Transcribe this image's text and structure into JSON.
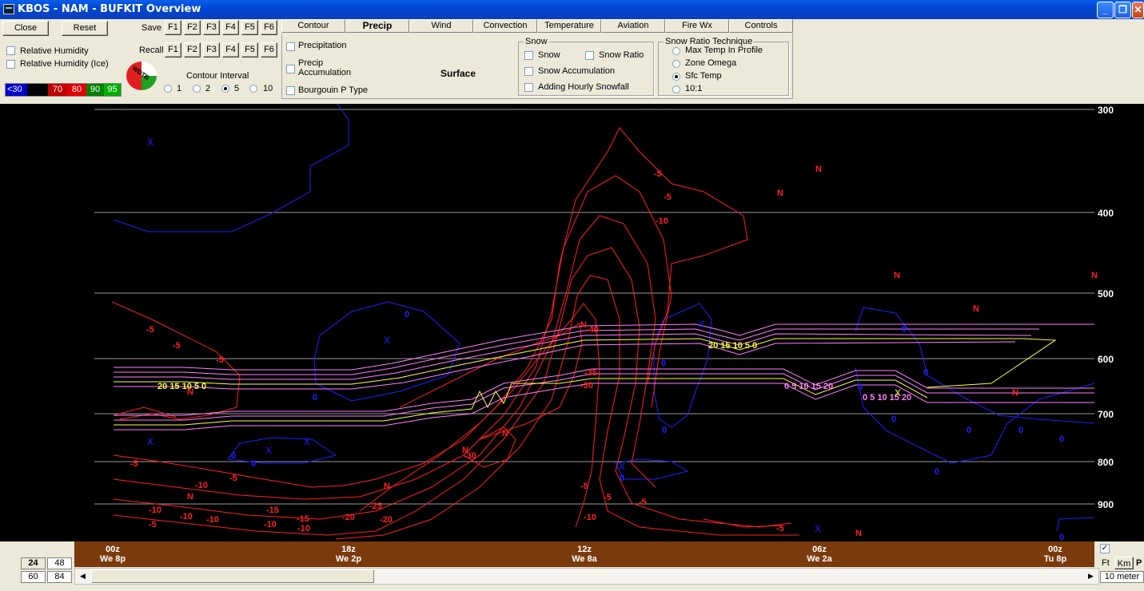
{
  "window": {
    "title": "KBOS - NAM - BUFKIT Overview",
    "controls": {
      "minimize": "_",
      "restore": "❐",
      "close": "✕"
    }
  },
  "toolbar": {
    "close_label": "Close",
    "reset_label": "Reset",
    "save_label": "Save",
    "recall_label": "Recall",
    "fkeys": [
      "F1",
      "F2",
      "F3",
      "F4",
      "F5",
      "F6"
    ],
    "rh_label": "Relative Humidity",
    "rh_ice_label": "Relative Humidity (Ice)",
    "color_scale": [
      {
        "label": "<30",
        "color": "#0000cc"
      },
      {
        "label": "",
        "color": "#000000"
      },
      {
        "label": "70",
        "color": "#c00000"
      },
      {
        "label": "80",
        "color": "#e00000"
      },
      {
        "label": "90",
        "color": "#008000"
      },
      {
        "label": "95",
        "color": "#00b000"
      }
    ],
    "contour_interval": {
      "label": "Contour Interval",
      "options": [
        "1",
        "2",
        "5",
        "10"
      ],
      "selected": "5"
    },
    "logo_text": "WDTB"
  },
  "tabs": [
    "Contour",
    "Precip",
    "Wind",
    "Convection",
    "Temperature",
    "Aviation",
    "Fire Wx",
    "Controls"
  ],
  "active_tab": "Precip",
  "precip_panel": {
    "precipitation": "Precipitation",
    "precip_accum_line1": "Precip",
    "precip_accum_line2": "Accumulation",
    "bourgouin": "Bourgouin P Type",
    "surface": "Surface"
  },
  "snow_group": {
    "title": "Snow",
    "snow": "Snow",
    "snow_ratio": "Snow Ratio",
    "snow_accum": "Snow Accumulation",
    "hourly": "Adding Hourly Snowfall"
  },
  "ratio_group": {
    "title": "Snow Ratio Technique",
    "options": [
      "Max Temp In Profile",
      "Zone Omega",
      "Sfc Temp",
      "10:1"
    ],
    "selected": "Sfc Temp"
  },
  "plot": {
    "pressure_levels": [
      "300",
      "400",
      "500",
      "600",
      "700",
      "800",
      "900"
    ],
    "marker_N": "N",
    "marker_X": "X",
    "colors": {
      "temp": "#ff2020",
      "rh": "#2020ff",
      "snowratio_pink": "#ff80ff",
      "snowratio_yellow": "#ffff40",
      "grid": "#9a9a9a"
    },
    "labels_red": [
      "-5",
      "-5",
      "-10",
      "-40",
      "-35",
      "-30",
      "-30",
      "-25",
      "-20",
      "-20",
      "-15",
      "-15",
      "-10",
      "-10",
      "-10",
      "-10",
      "-10",
      "-5",
      "-5",
      "-5",
      "-5",
      "-5",
      "-5",
      "-5",
      "-10",
      "-5",
      "-10",
      "-5",
      "-5"
    ],
    "labels_blue": [
      "0",
      "0",
      "0",
      "0",
      "0",
      "0",
      "0",
      "0",
      "0",
      "0",
      "0",
      "0",
      "0",
      "0",
      "0",
      "0"
    ],
    "snow_labels": [
      "20 15 10 5 0",
      "20 15 10 5 0",
      "0 5 10 15 20",
      "0 5 10 15 20"
    ]
  },
  "timeline": {
    "ticks": [
      {
        "z": "00z",
        "local": "We 8p"
      },
      {
        "z": "18z",
        "local": "We 2p"
      },
      {
        "z": "12z",
        "local": "We 8a"
      },
      {
        "z": "06z",
        "local": "We 2a"
      },
      {
        "z": "00z",
        "local": "Tu 8p"
      }
    ]
  },
  "durations": [
    "24",
    "48",
    "60",
    "84"
  ],
  "selected_duration": "24",
  "units": {
    "ft": "Ft",
    "km": "Km",
    "p": "P",
    "wind_height": "10 meter"
  }
}
